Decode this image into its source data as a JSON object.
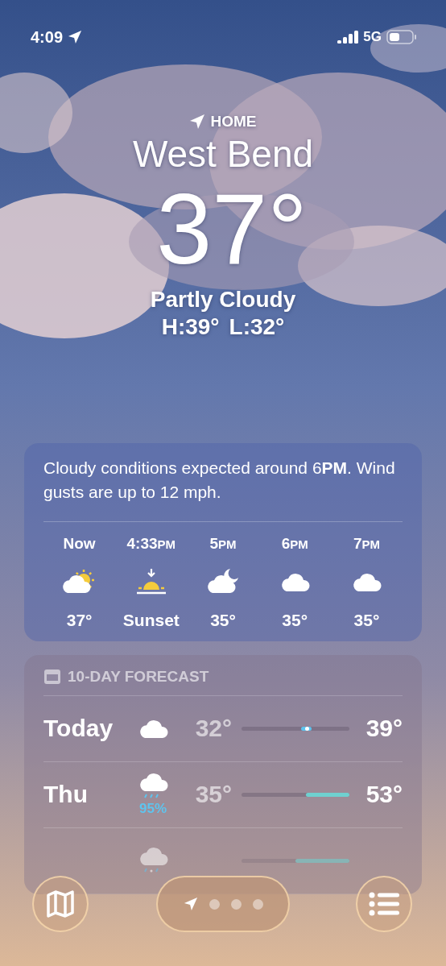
{
  "status_bar": {
    "time": "4:09",
    "network": "5G"
  },
  "header": {
    "location_label": "HOME",
    "city": "West Bend",
    "temperature": "37°",
    "condition": "Partly Cloudy",
    "high": "H:39°",
    "low": "L:32°"
  },
  "hourly": {
    "summary": "Cloudy conditions expected around 6**PM**. Wind gusts are up to 12 mph.",
    "hours": [
      {
        "time": "Now",
        "kind": "partly-sunny",
        "value": "37°"
      },
      {
        "time": "4:33**PM**",
        "kind": "sunset",
        "value": "Sunset"
      },
      {
        "time": "5**PM**",
        "kind": "partly-night",
        "value": "35°"
      },
      {
        "time": "6**PM**",
        "kind": "cloud",
        "value": "35°"
      },
      {
        "time": "7**PM**",
        "kind": "cloud",
        "value": "35°"
      }
    ]
  },
  "forecast": {
    "title": "10-DAY FORECAST",
    "days": [
      {
        "day": "Today",
        "kind": "cloud",
        "low": "32°",
        "high": "39°",
        "current": true,
        "level": 0.6
      },
      {
        "day": "Thu",
        "kind": "rain",
        "precip": "95%",
        "low": "35°",
        "high": "53°",
        "current": false,
        "level": 0.4
      },
      {
        "kind": "sleet",
        "current": false,
        "level": 0.5
      }
    ]
  }
}
